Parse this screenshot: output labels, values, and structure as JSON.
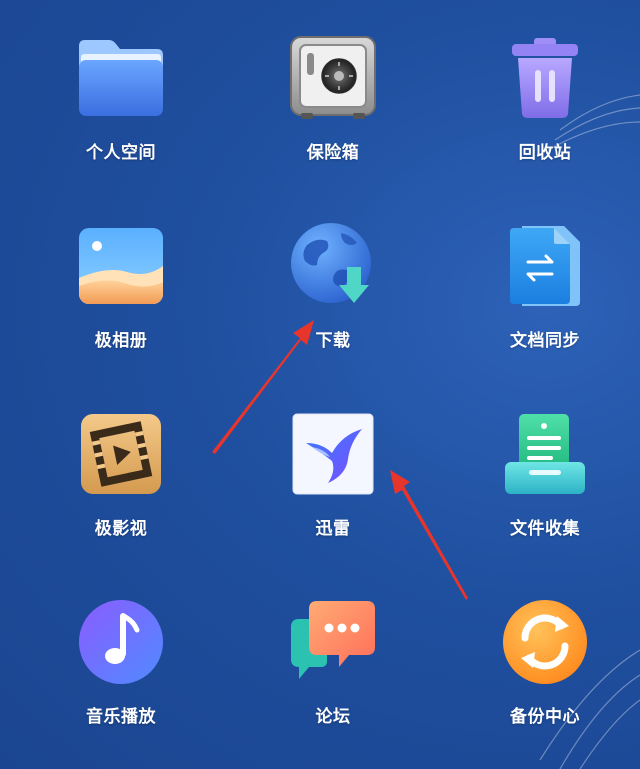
{
  "colors": {
    "background": "#1f4f9f",
    "label": "#ffffff",
    "annotation_arrow": "#e8352b"
  },
  "apps": [
    {
      "label": "个人空间",
      "icon": "folder-icon"
    },
    {
      "label": "保险箱",
      "icon": "safe-icon"
    },
    {
      "label": "回收站",
      "icon": "trash-icon"
    },
    {
      "label": "极相册",
      "icon": "photo-album-icon"
    },
    {
      "label": "下载",
      "icon": "download-globe-icon"
    },
    {
      "label": "文档同步",
      "icon": "document-sync-icon"
    },
    {
      "label": "极影视",
      "icon": "video-icon"
    },
    {
      "label": "迅雷",
      "icon": "xunlei-bird-icon"
    },
    {
      "label": "文件收集",
      "icon": "file-collect-icon"
    },
    {
      "label": "音乐播放",
      "icon": "music-note-icon"
    },
    {
      "label": "论坛",
      "icon": "forum-chat-icon"
    },
    {
      "label": "备份中心",
      "icon": "backup-sync-icon"
    }
  ]
}
